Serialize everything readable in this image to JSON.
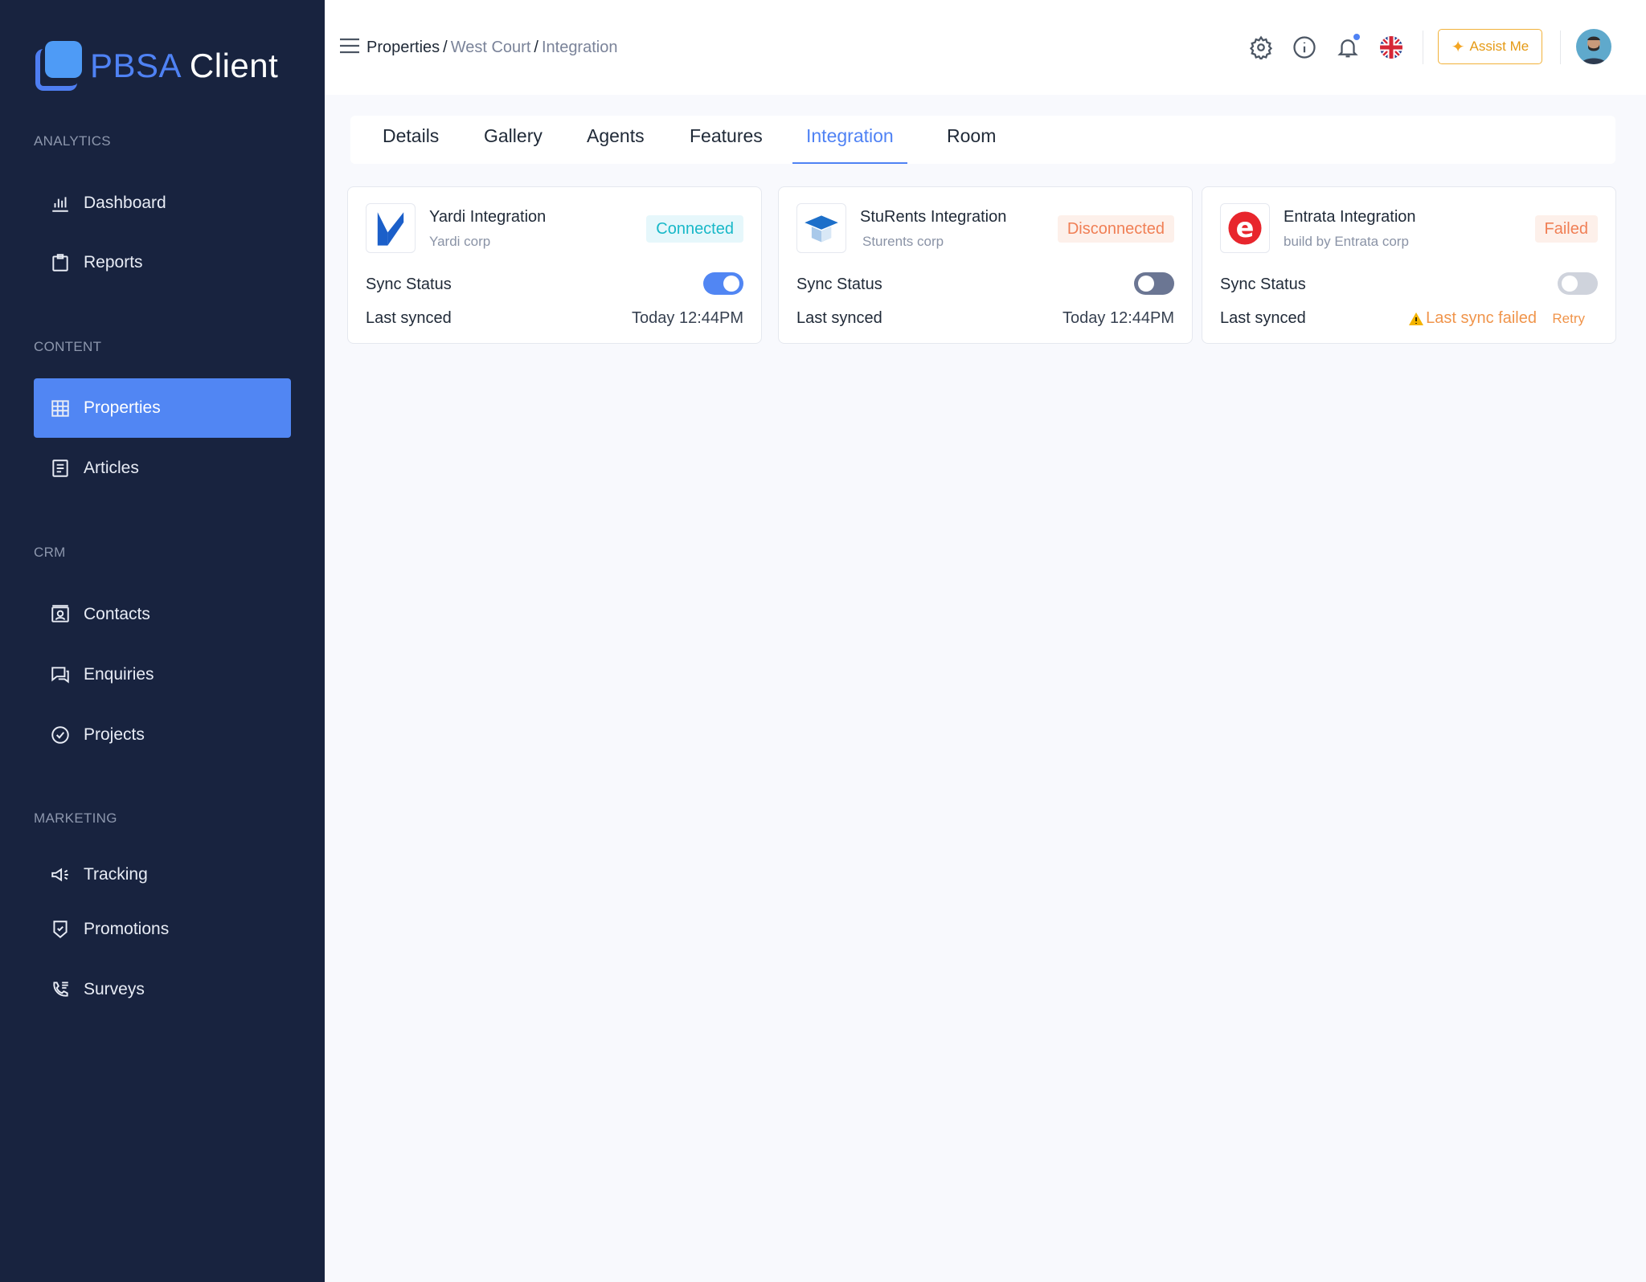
{
  "brand": {
    "name_part1": "PBSA",
    "name_part2": "Client"
  },
  "sidebar": {
    "sections": [
      {
        "label": "ANALYTICS"
      },
      {
        "label": "CONTENT"
      },
      {
        "label": "CRM"
      },
      {
        "label": "MARKETING"
      }
    ],
    "items": [
      {
        "label": "Dashboard",
        "icon": "bar-chart-icon"
      },
      {
        "label": "Reports",
        "icon": "clipboard-icon"
      },
      {
        "label": "Properties",
        "icon": "building-icon",
        "active": true
      },
      {
        "label": "Articles",
        "icon": "document-icon"
      },
      {
        "label": "Contacts",
        "icon": "contact-card-icon"
      },
      {
        "label": "Enquiries",
        "icon": "chat-icon"
      },
      {
        "label": "Projects",
        "icon": "check-circle-icon"
      },
      {
        "label": "Tracking",
        "icon": "megaphone-icon"
      },
      {
        "label": "Promotions",
        "icon": "shield-check-icon"
      },
      {
        "label": "Surveys",
        "icon": "phone-list-icon"
      }
    ]
  },
  "header": {
    "breadcrumb": [
      "Properties",
      "West Court",
      "Integration"
    ],
    "separator": "/",
    "assist_label": "Assist Me",
    "icons": [
      "menu-icon",
      "settings-icon",
      "info-icon",
      "bell-icon",
      "uk-flag-icon",
      "avatar"
    ]
  },
  "tabs": [
    "Details",
    "Gallery",
    "Agents",
    "Features",
    "Integration",
    "Room"
  ],
  "active_tab": "Integration",
  "cards": [
    {
      "title": "Yardi Integration",
      "subtitle": "Yardi corp",
      "status": "Connected",
      "sync_label": "Sync Status",
      "sync_on": true,
      "last_label": "Last synced",
      "last_value": "Today 12:44PM"
    },
    {
      "title": "StuRents Integration",
      "subtitle": "Sturents corp",
      "status": "Disconnected",
      "sync_label": "Sync Status",
      "sync_on": false,
      "last_label": "Last synced",
      "last_value": "Today 12:44PM"
    },
    {
      "title": "Entrata Integration",
      "subtitle": "build by Entrata corp",
      "status": "Failed",
      "sync_label": "Sync Status",
      "sync_on": false,
      "last_label": "Last synced",
      "last_value": "Last sync failed",
      "retry_label": "Retry"
    }
  ],
  "colors": {
    "sidebar_bg": "#18233f",
    "accent": "#5186f3",
    "connected": "#18b8c8",
    "warning": "#f0944a"
  }
}
